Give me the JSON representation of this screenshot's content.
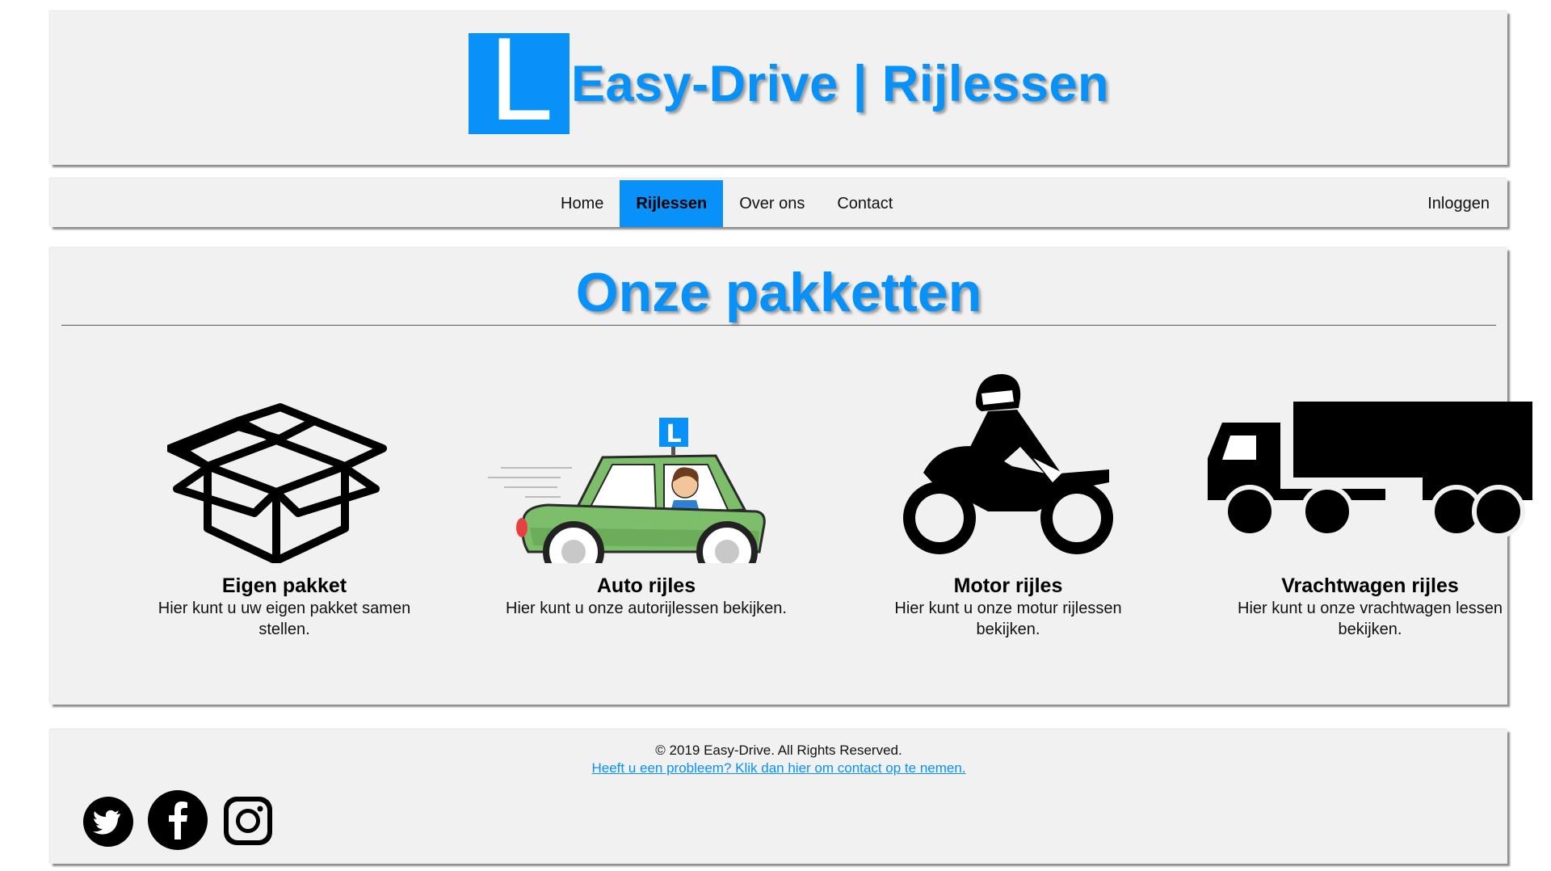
{
  "header": {
    "logo_letter": "L",
    "title": "Easy-Drive | Rijlessen"
  },
  "nav": {
    "items": [
      {
        "label": "Home"
      },
      {
        "label": "Rijlessen"
      },
      {
        "label": "Over ons"
      },
      {
        "label": "Contact"
      }
    ],
    "active": "Rijlessen",
    "login_label": "Inloggen"
  },
  "main": {
    "title": "Onze pakketten",
    "cards": [
      {
        "icon": "open-box-icon",
        "title": "Eigen pakket",
        "description": "Hier kunt u uw eigen pakket samen stellen."
      },
      {
        "icon": "learner-car-icon",
        "title": "Auto rijles",
        "description": "Hier kunt u onze autorijlessen bekijken."
      },
      {
        "icon": "motorcycle-icon",
        "title": "Motor rijles",
        "description": "Hier kunt u onze motur rijlessen bekijken."
      },
      {
        "icon": "truck-icon",
        "title": "Vrachtwagen rijles",
        "description": "Hier kunt u onze vrachtwagen lessen bekijken."
      }
    ]
  },
  "footer": {
    "copyright": "© 2019 Easy-Drive. All Rights Reserved.",
    "contact_link": "Heeft u een probleem? Klik dan hier om contact op te nemen.",
    "social": [
      "twitter-icon",
      "facebook-icon",
      "instagram-icon"
    ]
  },
  "colors": {
    "accent": "#0891f8",
    "panel": "#f1f1f1",
    "car": "#7dbe6b"
  }
}
